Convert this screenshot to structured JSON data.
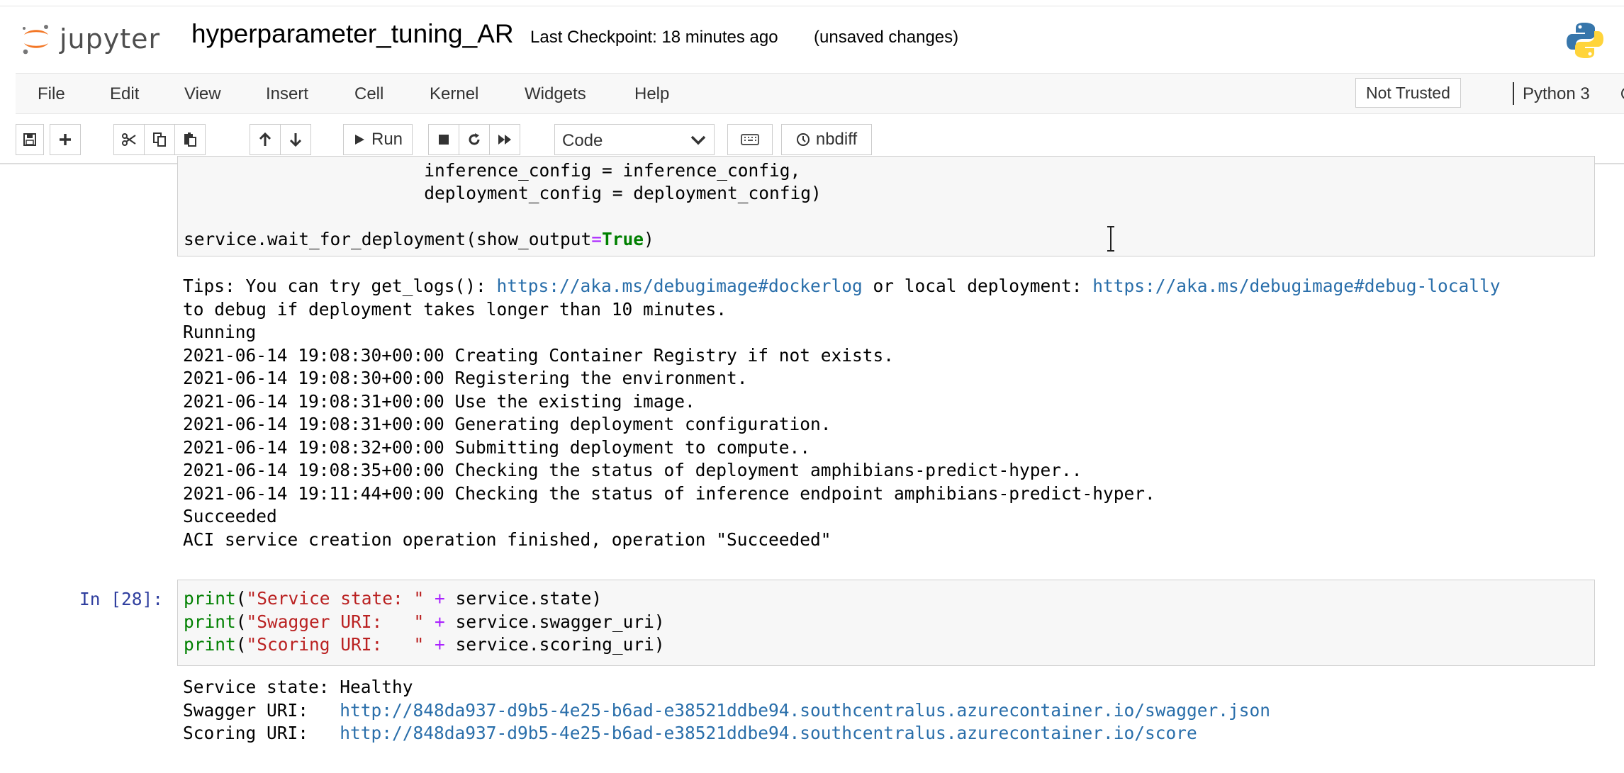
{
  "header": {
    "logo_text": "jupyter",
    "notebook_title": "hyperparameter_tuning_AR",
    "checkpoint": "Last Checkpoint: 18 minutes ago",
    "unsaved": "(unsaved changes)"
  },
  "menubar": {
    "items": [
      "File",
      "Edit",
      "View",
      "Insert",
      "Cell",
      "Kernel",
      "Widgets",
      "Help"
    ],
    "trust": "Not Trusted",
    "kernel": "Python 3"
  },
  "toolbar": {
    "run_label": "Run",
    "cell_type": "Code",
    "nbdiff_label": "nbdiff"
  },
  "cell1": {
    "code": [
      "                       inference_config = inference_config,",
      "                       deployment_config = deployment_config)",
      "",
      "service.wait_for_deployment(show_output=True)"
    ],
    "output": {
      "tips_prefix": "Tips: You can try get_logs(): ",
      "link1": "https://aka.ms/debugimage#dockerlog",
      "tips_middle": " or local deployment: ",
      "link2": "https://aka.ms/debugimage#debug-locally",
      "tips_line2": "to debug if deployment takes longer than 10 minutes.",
      "lines": [
        "Running",
        "2021-06-14 19:08:30+00:00 Creating Container Registry if not exists.",
        "2021-06-14 19:08:30+00:00 Registering the environment.",
        "2021-06-14 19:08:31+00:00 Use the existing image.",
        "2021-06-14 19:08:31+00:00 Generating deployment configuration.",
        "2021-06-14 19:08:32+00:00 Submitting deployment to compute..",
        "2021-06-14 19:08:35+00:00 Checking the status of deployment amphibians-predict-hyper..",
        "2021-06-14 19:11:44+00:00 Checking the status of inference endpoint amphibians-predict-hyper.",
        "Succeeded",
        "ACI service creation operation finished, operation \"Succeeded\""
      ]
    }
  },
  "cell2": {
    "prompt": "In [28]:",
    "code_lines": [
      {
        "fn": "print",
        "lp": "(",
        "str": "\"Service state: \"",
        "op": " + ",
        "rest": "service.state)"
      },
      {
        "fn": "print",
        "lp": "(",
        "str": "\"Swagger URI:   \"",
        "op": " + ",
        "rest": "service.swagger_uri)"
      },
      {
        "fn": "print",
        "lp": "(",
        "str": "\"Scoring URI:   \"",
        "op": " + ",
        "rest": "service.scoring_uri)"
      }
    ],
    "output": {
      "state_line": "Service state: Healthy",
      "swagger_label": "Swagger URI:   ",
      "swagger_url": "http://848da937-d9b5-4e25-b6ad-e38521ddbe94.southcentralus.azurecontainer.io/swagger.json",
      "scoring_label": "Scoring URI:   ",
      "scoring_url": "http://848da937-d9b5-4e25-b6ad-e38521ddbe94.southcentralus.azurecontainer.io/score"
    }
  },
  "colors": {
    "keyword_true": "#008000",
    "operator": "#aa22ff",
    "string": "#ba2121",
    "link": "#296eaa",
    "prompt": "#303f9f"
  }
}
